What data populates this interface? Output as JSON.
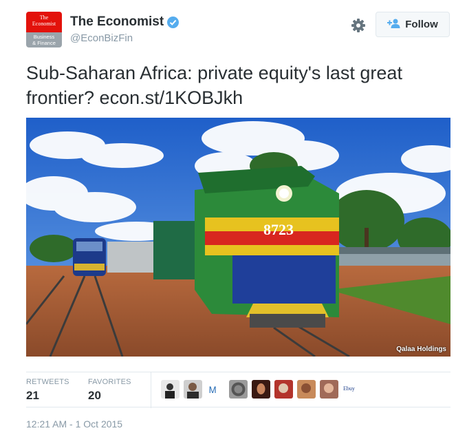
{
  "account": {
    "logo_line1": "The",
    "logo_line2": "Economist",
    "logo_sub1": "Business",
    "logo_sub2": "& Finance",
    "display_name": "The Economist",
    "handle": "@EconBizFin",
    "verified": true
  },
  "actions": {
    "settings_icon": "gear-icon",
    "follow_label": "Follow",
    "follow_icon": "person-plus-icon"
  },
  "tweet": {
    "text": "Sub-Saharan Africa: private equity's last great frontier? econ.st/1KOBJkh",
    "timestamp": "12:21 AM - 1 Oct 2015"
  },
  "media": {
    "locomotive_number": "8723",
    "credit": "Qalaa Holdings"
  },
  "stats": {
    "retweets_label": "RETWEETS",
    "retweets_count": "21",
    "favorites_label": "FAVORITES",
    "favorites_count": "20"
  },
  "favoriters": {
    "ebay_label": "Ebuy"
  },
  "colors": {
    "brand_red": "#e3120b",
    "verified_blue": "#55acee",
    "muted_text": "#8899a6"
  }
}
